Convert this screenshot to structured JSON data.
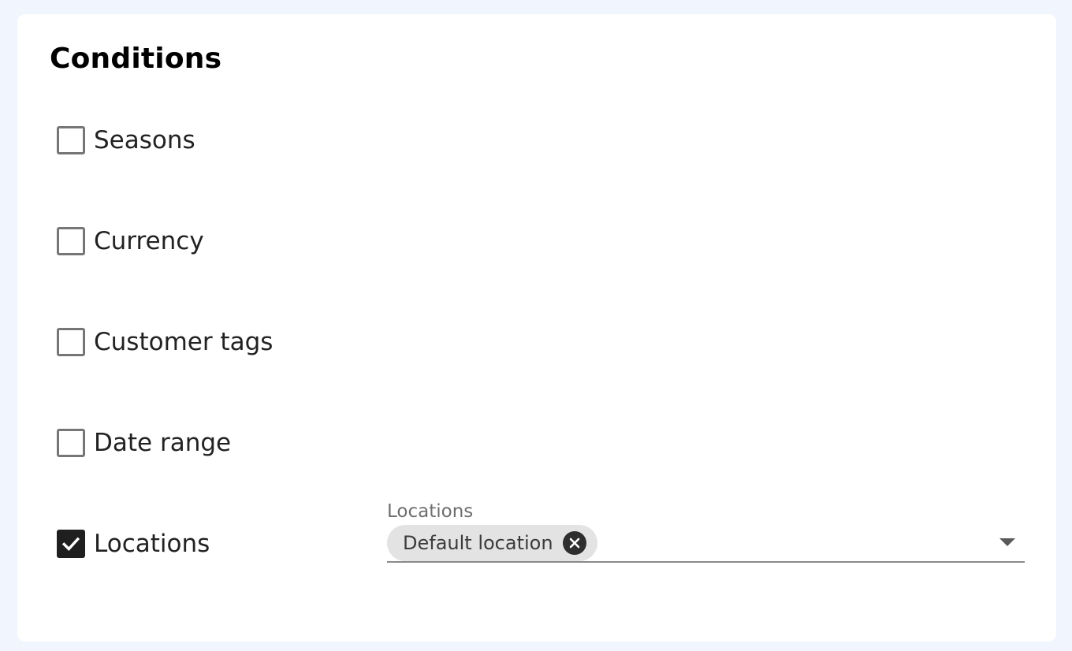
{
  "section": {
    "title": "Conditions"
  },
  "conditions": [
    {
      "label": "Seasons",
      "checked": false
    },
    {
      "label": "Currency",
      "checked": false
    },
    {
      "label": "Customer tags",
      "checked": false
    },
    {
      "label": "Date range",
      "checked": false
    },
    {
      "label": "Locations",
      "checked": true
    }
  ],
  "locations_select": {
    "label": "Locations",
    "selected": [
      {
        "label": "Default location"
      }
    ],
    "icons": {
      "chip_remove": "close-circle-icon",
      "dropdown": "caret-down-icon"
    }
  },
  "colors": {
    "page_background": "#f1f5fd",
    "card_background": "#ffffff",
    "checkbox_checked": "#1f1f1f",
    "chip_background": "#e3e3e3"
  }
}
